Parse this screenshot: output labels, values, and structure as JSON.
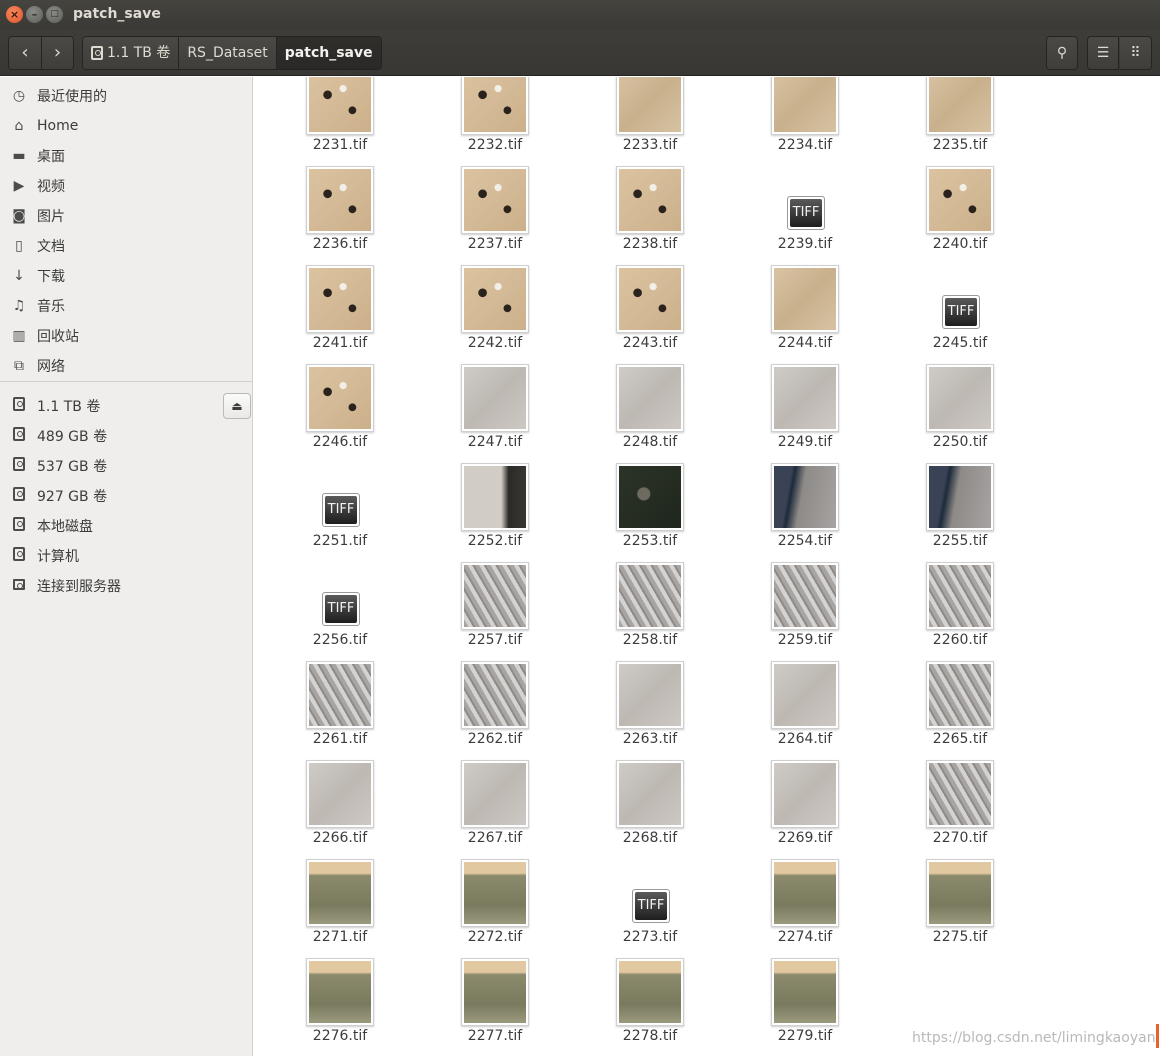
{
  "window": {
    "title": "patch_save",
    "close_glyph": "×",
    "min_glyph": "–",
    "max_glyph": "□"
  },
  "toolbar": {
    "back_glyph": "‹",
    "forward_glyph": "›",
    "search_glyph": "⚲",
    "list_glyph": "☰",
    "grid_glyph": "⠿",
    "breadcrumbs": [
      "1.1 TB 卷",
      "RS_Dataset",
      "patch_save"
    ]
  },
  "sidebar": {
    "places": [
      {
        "label": "最近使用的",
        "icon": "clock-icon",
        "glyph": "◷"
      },
      {
        "label": "Home",
        "icon": "home-icon",
        "glyph": "⌂"
      },
      {
        "label": "桌面",
        "icon": "folder-icon",
        "glyph": "▬"
      },
      {
        "label": "视频",
        "icon": "video-icon",
        "glyph": "▶"
      },
      {
        "label": "图片",
        "icon": "camera-icon",
        "glyph": "◙"
      },
      {
        "label": "文档",
        "icon": "document-icon",
        "glyph": "▯"
      },
      {
        "label": "下载",
        "icon": "download-icon",
        "glyph": "↓"
      },
      {
        "label": "音乐",
        "icon": "music-icon",
        "glyph": "♫"
      },
      {
        "label": "回收站",
        "icon": "trash-icon",
        "glyph": "▥"
      },
      {
        "label": "网络",
        "icon": "network-icon",
        "glyph": "⧉"
      }
    ],
    "devices": [
      {
        "label": "1.1 TB 卷",
        "icon": "disk-icon"
      },
      {
        "label": "489 GB 卷",
        "icon": "disk-icon"
      },
      {
        "label": "537 GB 卷",
        "icon": "disk-icon"
      },
      {
        "label": "927 GB 卷",
        "icon": "disk-icon"
      },
      {
        "label": "本地磁盘",
        "icon": "disk-icon"
      },
      {
        "label": "计算机",
        "icon": "disk-icon"
      },
      {
        "label": "连接到服务器",
        "icon": "server-icon"
      }
    ],
    "eject_glyph": "⏏"
  },
  "files": [
    {
      "name": "2231.tif",
      "kind": "sand-dark"
    },
    {
      "name": "2232.tif",
      "kind": "sand-dark"
    },
    {
      "name": "2233.tif",
      "kind": "sand"
    },
    {
      "name": "2234.tif",
      "kind": "sand"
    },
    {
      "name": "2235.tif",
      "kind": "sand"
    },
    {
      "name": "2236.tif",
      "kind": "sand-dark"
    },
    {
      "name": "2237.tif",
      "kind": "sand-dark"
    },
    {
      "name": "2238.tif",
      "kind": "sand-dark"
    },
    {
      "name": "2239.tif",
      "kind": "tiff"
    },
    {
      "name": "2240.tif",
      "kind": "sand-dark"
    },
    {
      "name": "2241.tif",
      "kind": "sand-dark"
    },
    {
      "name": "2242.tif",
      "kind": "sand-dark"
    },
    {
      "name": "2243.tif",
      "kind": "sand-dark"
    },
    {
      "name": "2244.tif",
      "kind": "sand"
    },
    {
      "name": "2245.tif",
      "kind": "tiff"
    },
    {
      "name": "2246.tif",
      "kind": "sand-dark"
    },
    {
      "name": "2247.tif",
      "kind": "grey"
    },
    {
      "name": "2248.tif",
      "kind": "grey"
    },
    {
      "name": "2249.tif",
      "kind": "grey"
    },
    {
      "name": "2250.tif",
      "kind": "grey"
    },
    {
      "name": "2251.tif",
      "kind": "tiff"
    },
    {
      "name": "2252.tif",
      "kind": "grey-dark"
    },
    {
      "name": "2253.tif",
      "kind": "dark"
    },
    {
      "name": "2254.tif",
      "kind": "city"
    },
    {
      "name": "2255.tif",
      "kind": "city"
    },
    {
      "name": "2256.tif",
      "kind": "tiff"
    },
    {
      "name": "2257.tif",
      "kind": "ridge"
    },
    {
      "name": "2258.tif",
      "kind": "ridge"
    },
    {
      "name": "2259.tif",
      "kind": "ridge"
    },
    {
      "name": "2260.tif",
      "kind": "ridge"
    },
    {
      "name": "2261.tif",
      "kind": "ridge"
    },
    {
      "name": "2262.tif",
      "kind": "ridge"
    },
    {
      "name": "2263.tif",
      "kind": "grey"
    },
    {
      "name": "2264.tif",
      "kind": "grey"
    },
    {
      "name": "2265.tif",
      "kind": "ridge"
    },
    {
      "name": "2266.tif",
      "kind": "grey"
    },
    {
      "name": "2267.tif",
      "kind": "grey"
    },
    {
      "name": "2268.tif",
      "kind": "grey"
    },
    {
      "name": "2269.tif",
      "kind": "grey"
    },
    {
      "name": "2270.tif",
      "kind": "ridge"
    },
    {
      "name": "2271.tif",
      "kind": "olive"
    },
    {
      "name": "2272.tif",
      "kind": "olive"
    },
    {
      "name": "2273.tif",
      "kind": "tiff"
    },
    {
      "name": "2274.tif",
      "kind": "olive"
    },
    {
      "name": "2275.tif",
      "kind": "olive"
    },
    {
      "name": "2276.tif",
      "kind": "olive"
    },
    {
      "name": "2277.tif",
      "kind": "olive"
    },
    {
      "name": "2278.tif",
      "kind": "olive"
    },
    {
      "name": "2279.tif",
      "kind": "olive"
    }
  ],
  "tiff_label": "TIFF",
  "watermark": "https://blog.csdn.net/limingkaoyan"
}
